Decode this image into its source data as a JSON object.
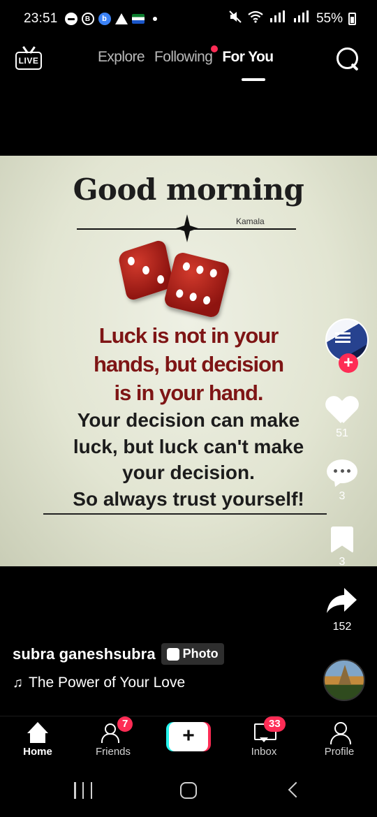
{
  "status_bar": {
    "time": "23:51",
    "left_icons": [
      "do-not-disturb-icon",
      "b-icon",
      "b-blue-icon",
      "warning-icon",
      "flag-icon"
    ],
    "battery": "55%",
    "right_icons": [
      "mute-icon",
      "wifi-icon",
      "signal-icon",
      "signal-icon",
      "battery-icon"
    ]
  },
  "top_nav": {
    "live_label": "LIVE",
    "tabs": [
      {
        "label": "Explore"
      },
      {
        "label": "Following"
      },
      {
        "label": "For You"
      }
    ]
  },
  "post": {
    "title": "Good morning",
    "signature": "Kamala",
    "quote_red_lines": [
      "Luck is not in your",
      "hands, but decision",
      "is in your hand."
    ],
    "quote_dark_lines": [
      "Your decision can make",
      "luck, but luck can't make",
      "your decision.",
      "So always trust yourself!"
    ]
  },
  "actions": {
    "follow_label": "+",
    "likes": "51",
    "comments": "3",
    "saves": "3",
    "shares": "152"
  },
  "author": {
    "name": "subra ganeshsubra",
    "badge": "Photo"
  },
  "music": {
    "title": "The Power of Your Love"
  },
  "bottom_nav": {
    "items": [
      {
        "label": "Home"
      },
      {
        "label": "Friends",
        "badge": "7"
      },
      {
        "label": "+"
      },
      {
        "label": "Inbox",
        "badge": "33"
      },
      {
        "label": "Profile"
      }
    ]
  },
  "colors": {
    "accent": "#fe2c55",
    "secondary_accent": "#25f4ee",
    "quote_red": "#7e1515",
    "image_background": "#e2e5d2"
  }
}
